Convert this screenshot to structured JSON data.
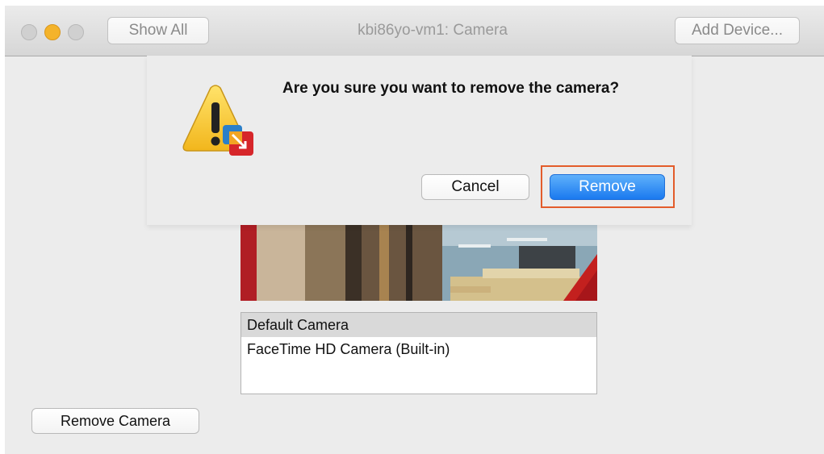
{
  "window": {
    "title": "kbi86yo-vm1: Camera",
    "toolbar": {
      "show_all_label": "Show All",
      "add_device_label": "Add Device..."
    }
  },
  "alert": {
    "message": "Are you sure you want to remove the camera?",
    "cancel_label": "Cancel",
    "remove_label": "Remove",
    "icon": "warning-icon"
  },
  "camera_list": {
    "items": [
      {
        "label": "Default Camera",
        "selected": true
      },
      {
        "label": "FaceTime HD Camera (Built-in)",
        "selected": false
      }
    ]
  },
  "footer": {
    "remove_camera_label": "Remove Camera"
  },
  "colors": {
    "accent_button": "#1a79ef",
    "highlight_box": "#e35c2b",
    "minimize_light": "#f4b32a"
  }
}
